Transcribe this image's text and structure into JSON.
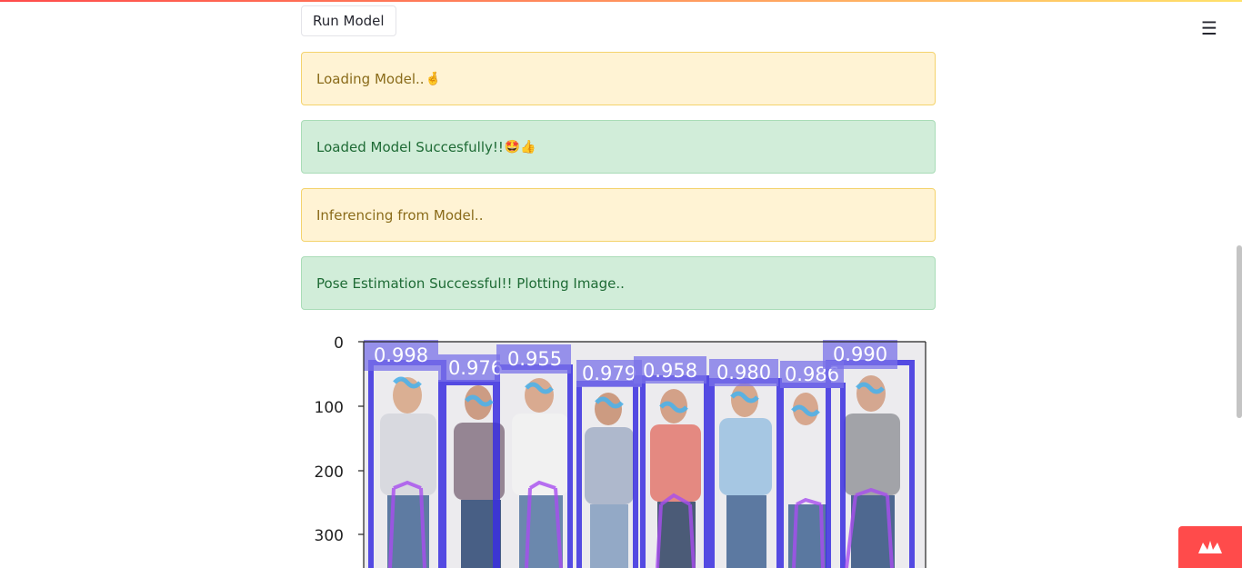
{
  "header": {
    "menu_icon": "hamburger-icon",
    "accent_gradient": [
      "#ff4b4b",
      "#ffe26a"
    ]
  },
  "controls": {
    "run_button_label": "Run Model"
  },
  "alerts": [
    {
      "kind": "warning",
      "text": "Loading Model..",
      "emoji": "🤞"
    },
    {
      "kind": "success",
      "text": "Loaded Model Succesfully!!",
      "emoji": "🤩👍"
    },
    {
      "kind": "warning",
      "text": "Inferencing from Model.."
    },
    {
      "kind": "success",
      "text": "Pose Estimation Successful!! Plotting Image.."
    }
  ],
  "plot": {
    "y_ticks": [
      "0",
      "100",
      "200",
      "300"
    ],
    "confidence_labels": [
      "0.998",
      "0.976",
      "0.955",
      "0.979",
      "0.958",
      "0.980",
      "0.986",
      "0.990"
    ]
  },
  "colors": {
    "warning_bg": "#fff3d4",
    "success_bg": "#d1edd9",
    "box_color": "#3a2fe0",
    "badge": "#ff4b4b"
  },
  "footer": {
    "badge_icon": "streamlit-crown-icon"
  }
}
